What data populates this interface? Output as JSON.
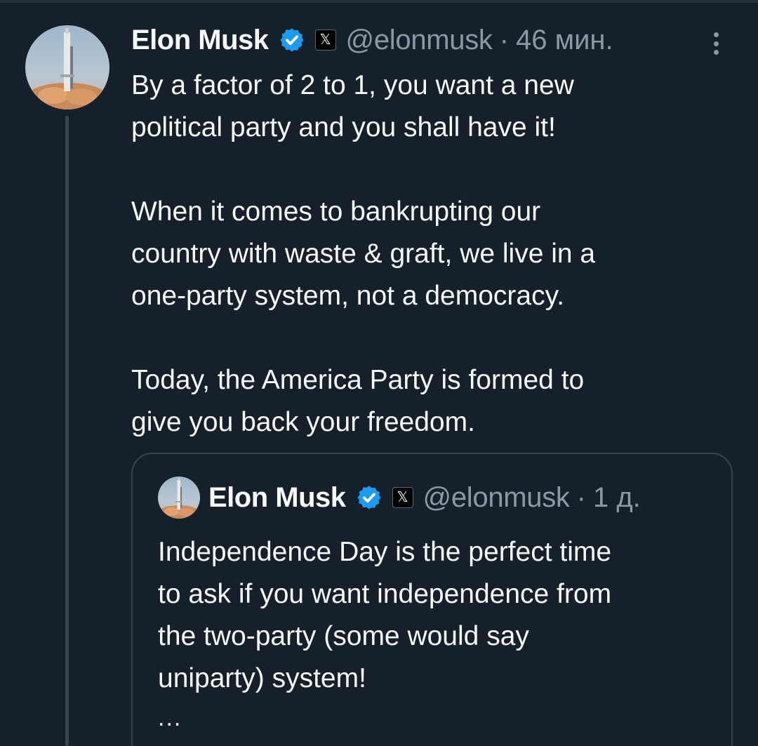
{
  "tweet": {
    "author_name": "Elon Musk",
    "handle": "@elonmusk",
    "separator": "·",
    "time": "46 мин.",
    "avatar_icon": "rocket-launch-avatar",
    "paragraphs": [
      [
        "By a factor of 2 to 1, you want a new",
        "political party and you shall have it!"
      ],
      [
        "When it comes to bankrupting our",
        "country with waste & graft, we live in a",
        "one-party system, not a democracy."
      ],
      [
        "Today, the America Party is formed to",
        "give you back your freedom."
      ]
    ]
  },
  "quoted_tweet": {
    "author_name": "Elon Musk",
    "handle": "@elonmusk",
    "separator": "·",
    "time": "1 д.",
    "avatar_icon": "rocket-launch-avatar",
    "lines": [
      "Independence Day is the perfect time",
      "to ask if you want independence from",
      "the two-party (some would say",
      "uniparty) system!"
    ],
    "truncation": "..."
  },
  "icons": {
    "verified": "verified-badge-icon",
    "affiliate": "x-logo-icon",
    "x_glyph": "𝕏",
    "more": "more-options-icon"
  },
  "colors": {
    "background": "#15202b",
    "text": "#f7f9f9",
    "secondary_text": "#8b98a5",
    "verified_blue": "#1d9bf0",
    "border": "#38444d"
  }
}
